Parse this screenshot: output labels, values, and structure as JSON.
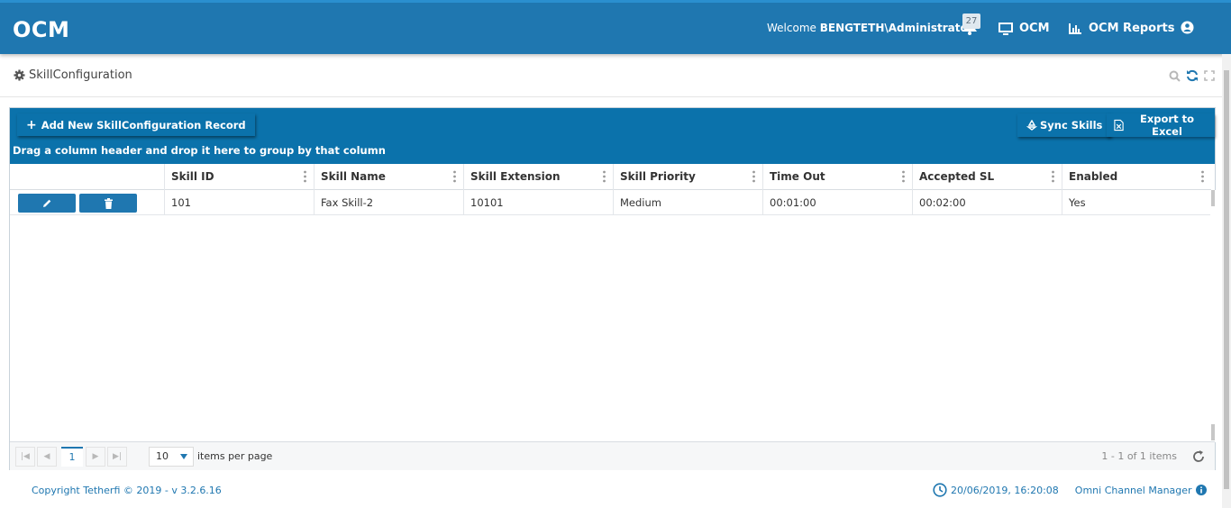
{
  "header": {
    "logo": "OCM",
    "welcome_prefix": "Welcome",
    "user": "BENGTETH\\Administrator",
    "notification_count": "27",
    "nav": [
      {
        "label": "OCM",
        "icon": "monitor-icon"
      },
      {
        "label": "OCM Reports",
        "icon": "bar-chart-icon"
      }
    ],
    "user_icon": "user-circle-icon"
  },
  "page": {
    "title": "SkillConfiguration",
    "title_icon": "gear-icon",
    "tools": [
      "search-icon",
      "refresh-icon",
      "expand-icon"
    ]
  },
  "toolbar": {
    "add_label": "Add New SkillConfiguration Record",
    "sync_label": "Sync Skills",
    "export_label": "Export to Excel",
    "group_hint": "Drag a column header and drop it here to group by that column"
  },
  "grid": {
    "columns": [
      "Skill ID",
      "Skill Name",
      "Skill Extension",
      "Skill Priority",
      "Time Out",
      "Accepted SL",
      "Enabled"
    ],
    "rows": [
      [
        "101",
        "Fax Skill-2",
        "10101",
        "Medium",
        "00:01:00",
        "00:02:00",
        "Yes"
      ]
    ]
  },
  "pager": {
    "current_page": "1",
    "page_size": "10",
    "page_size_label": "items per page",
    "info": "1 - 1 of 1 items"
  },
  "footer": {
    "copyright": "Copyright Tetherfi © 2019 - v 3.2.6.16",
    "datetime": "20/06/2019, 16:20:08",
    "app_name": "Omni Channel Manager"
  },
  "colors": {
    "primary": "#1f77b0",
    "toolbar": "#0b72ab"
  }
}
